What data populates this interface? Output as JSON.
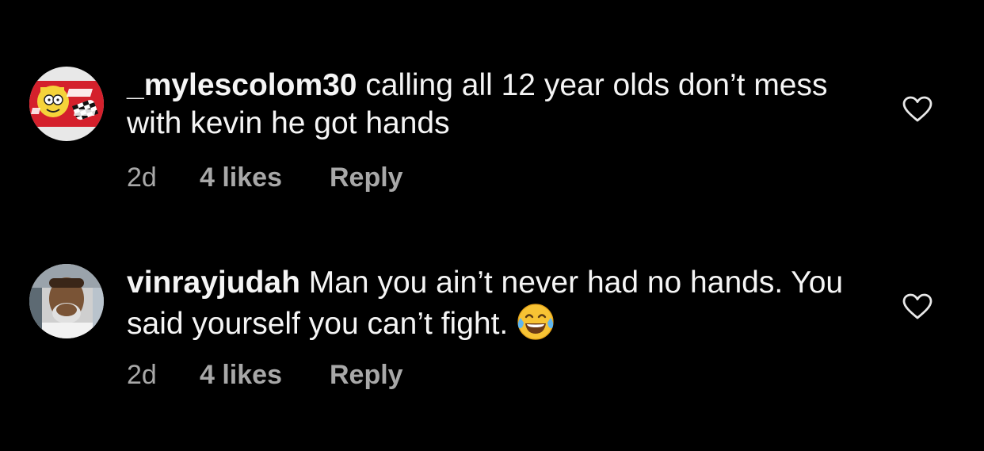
{
  "comments": [
    {
      "username": "_mylescolom30",
      "text": "calling all 12 year olds don’t mess with kevin he got hands",
      "emoji": "",
      "time": "2d",
      "likes": "4 likes",
      "reply_label": "Reply",
      "avatar_icon": "simpson-supreme-avatar",
      "heart_icon": "heart-outline-icon"
    },
    {
      "username": "vinrayjudah",
      "text": "Man you ain’t never had no hands. You said yourself you can’t fight.",
      "emoji": "😂",
      "time": "2d",
      "likes": "4 likes",
      "reply_label": "Reply",
      "avatar_icon": "profile-photo-avatar",
      "heart_icon": "heart-outline-icon"
    }
  ],
  "colors": {
    "background": "#000000",
    "text": "#f5f5f5",
    "meta": "#a8a8a8"
  }
}
